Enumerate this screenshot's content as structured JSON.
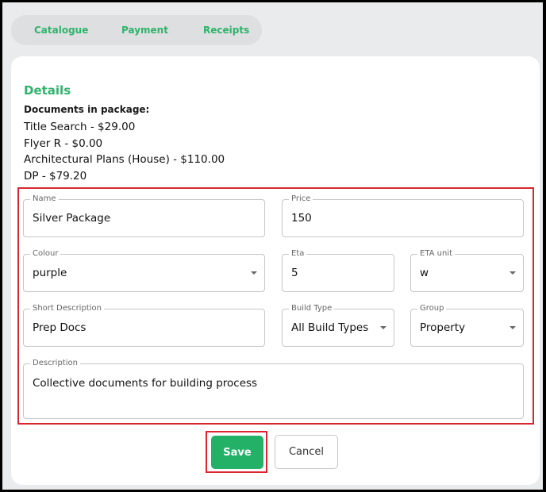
{
  "tabs": [
    {
      "label": "Catalogue"
    },
    {
      "label": "Payment"
    },
    {
      "label": "Receipts"
    }
  ],
  "details": {
    "title": "Details",
    "documents_label": "Documents in package:",
    "documents": [
      "Title Search - $29.00",
      "Flyer R - $0.00",
      "Architectural Plans (House) - $110.00",
      "DP - $79.20"
    ]
  },
  "form": {
    "name": {
      "label": "Name",
      "value": "Silver Package"
    },
    "price": {
      "label": "Price",
      "value": "150"
    },
    "colour": {
      "label": "Colour",
      "value": "purple"
    },
    "eta": {
      "label": "Eta",
      "value": "5"
    },
    "eta_unit": {
      "label": "ETA unit",
      "value": "w"
    },
    "short_description": {
      "label": "Short Description",
      "value": "Prep Docs"
    },
    "build_type": {
      "label": "Build Type",
      "value": "All Build Types"
    },
    "group": {
      "label": "Group",
      "value": "Property"
    },
    "description": {
      "label": "Description",
      "value": "Collective documents for building process"
    }
  },
  "actions": {
    "save_label": "Save",
    "cancel_label": "Cancel"
  },
  "colors": {
    "accent": "#2fb36b",
    "save_button": "#22b167",
    "highlight": "#d9262f"
  }
}
